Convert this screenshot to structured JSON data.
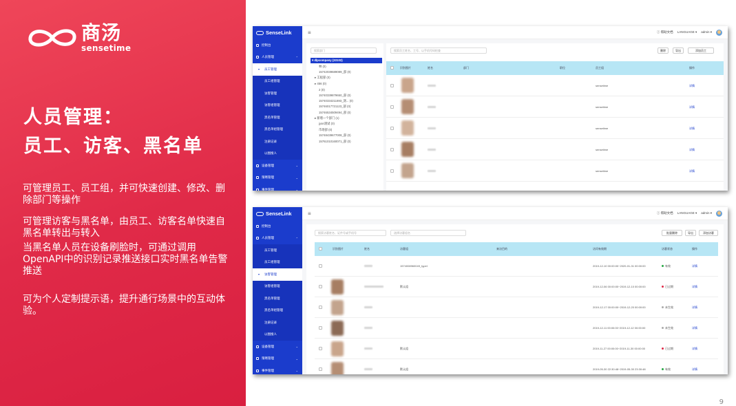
{
  "brand": {
    "name_cn": "商汤",
    "name_en": "sensetime"
  },
  "slide": {
    "title_line1": "人员管理：",
    "title_line2": "员工、访客、黑名单",
    "para1": "可管理员工、员工组，并可快速创建、修改、删除部门等操作",
    "para2": "可管理访客与黑名单，由员工、访客名单快速自黑名单转出与转入",
    "para3": "当黑名单人员在设备刷脸时，可通过调用OpenAPI中的识别记录推送接口实时黑名单告警推送",
    "para4": "可为个人定制提示语，提升通行场景中的互动体验。",
    "page_number": "9"
  },
  "app": {
    "logo": "SenseLink",
    "help": "帮助文档",
    "language": "LANGUAGE",
    "user": "admin"
  },
  "shot1": {
    "sidebar": [
      {
        "label": "控制台",
        "kind": "top"
      },
      {
        "label": "人员管理",
        "kind": "top",
        "caret": "⌃"
      },
      {
        "label": "员工管理",
        "kind": "parent-active",
        "caret": "▾"
      },
      {
        "label": "员工组管理",
        "kind": "sub"
      },
      {
        "label": "访客管理",
        "kind": "sub"
      },
      {
        "label": "访客组管理",
        "kind": "sub"
      },
      {
        "label": "黑名单管理",
        "kind": "sub"
      },
      {
        "label": "黑名单组管理",
        "kind": "sub"
      },
      {
        "label": "注册记录",
        "kind": "sub"
      },
      {
        "label": "以图搜人",
        "kind": "sub"
      },
      {
        "label": "设备管理",
        "kind": "top",
        "caret": "⌄"
      },
      {
        "label": "策略管理",
        "kind": "top",
        "caret": "⌄"
      },
      {
        "label": "事件管理",
        "kind": "top",
        "caret": "⌄"
      }
    ],
    "dept_search_placeholder": "搜索部门",
    "staff_search_placeholder": "搜索员工姓名、工号、以手机号码检查",
    "buttons": [
      "删除",
      "导出",
      "添加员工"
    ],
    "tree": [
      {
        "label": "▾ dlpcompany (33102)",
        "selected": true,
        "indent": 0
      },
      {
        "label": "林 (0)",
        "indent": 2
      },
      {
        "label": "15742039689089_部 (0)",
        "indent": 2
      },
      {
        "label": "▸ 工程部 (0)",
        "indent": 1
      },
      {
        "label": "▸ 456 (0)",
        "indent": 1
      },
      {
        "label": "2 (0)",
        "indent": 2
      },
      {
        "label": "15740339879650_部 (0)",
        "indent": 2
      },
      {
        "label": "15740334211693_测... (0)",
        "indent": 2
      },
      {
        "label": "15746017721123_部 (0)",
        "indent": 2
      },
      {
        "label": "15746534509494_部 (0)",
        "indent": 2
      },
      {
        "label": "▸ 新增一个部门 (1)",
        "indent": 1
      },
      {
        "label": "jyan测试 (0)",
        "indent": 2
      },
      {
        "label": "市场部 (0)",
        "indent": 2
      },
      {
        "label": "15748439677008_部 (0)",
        "indent": 2
      },
      {
        "label": "15761010160071_部 (0)",
        "indent": 2
      }
    ],
    "columns": [
      "识别图片",
      "姓名",
      "部门",
      "职位",
      "员工组",
      "操作"
    ],
    "rows": [
      {
        "group": "sensetime",
        "action": "详情"
      },
      {
        "group": "sensetime",
        "action": "详情"
      },
      {
        "group": "sensetime",
        "action": "详情"
      },
      {
        "group": "sensetime",
        "action": "详情"
      },
      {
        "group": "sensetime",
        "action": "详情"
      }
    ]
  },
  "shot2": {
    "sidebar": [
      {
        "label": "控制台",
        "kind": "top"
      },
      {
        "label": "人员管理",
        "kind": "top",
        "caret": "⌃"
      },
      {
        "label": "员工管理",
        "kind": "sub"
      },
      {
        "label": "员工组管理",
        "kind": "sub"
      },
      {
        "label": "访客管理",
        "kind": "parent-active",
        "caret": "▾"
      },
      {
        "label": "访客组管理",
        "kind": "sub"
      },
      {
        "label": "黑名单管理",
        "kind": "sub"
      },
      {
        "label": "黑名单组管理",
        "kind": "sub"
      },
      {
        "label": "注册记录",
        "kind": "sub"
      },
      {
        "label": "以图搜人",
        "kind": "sub"
      },
      {
        "label": "设备管理",
        "kind": "top",
        "caret": "⌄"
      },
      {
        "label": "策略管理",
        "kind": "top",
        "caret": "⌄"
      },
      {
        "label": "事件管理",
        "kind": "top",
        "caret": "⌄"
      }
    ],
    "search_placeholder": "搜索访客姓名、证件号或手机号",
    "group_placeholder": "选择访客组名",
    "buttons": [
      "批量删除",
      "导出",
      "添加访客"
    ],
    "columns": [
      "识别图片",
      "姓名",
      "访客组",
      "来访目的",
      "访问有效期",
      "访客状态",
      "操作"
    ],
    "rows": [
      {
        "group": "1574008960049_typeI",
        "period": "2019-12-10 00:00:00~2020-01-31 00:00:00",
        "status": "有效",
        "status_color": "#27a844",
        "action": "详情"
      },
      {
        "group": "默认组",
        "period": "2019-12-06 00:00:00~2019-12-10 00:00:00",
        "status": "已过期",
        "status_color": "#e02a48",
        "action": "详情"
      },
      {
        "group": "",
        "period": "2019-12-17 00:00:00~2019-12-20 00:00:00",
        "status": "未生效",
        "status_color": "#aaaaaa",
        "action": "详情"
      },
      {
        "group": "",
        "period": "2019-12-11 00:00:00~2019-12-12 00:00:00",
        "status": "未生效",
        "status_color": "#aaaaaa",
        "action": "详情"
      },
      {
        "group": "默认组",
        "period": "2019-11-27 00:00:00~2019-11-30 00:00:00",
        "status": "已过期",
        "status_color": "#e02a48",
        "action": "详情"
      },
      {
        "group": "默认组",
        "period": "2019-05-30 22:30:48~2019-05-30 23:30:48",
        "status": "有效",
        "status_color": "#27a844",
        "action": "详情"
      }
    ]
  }
}
